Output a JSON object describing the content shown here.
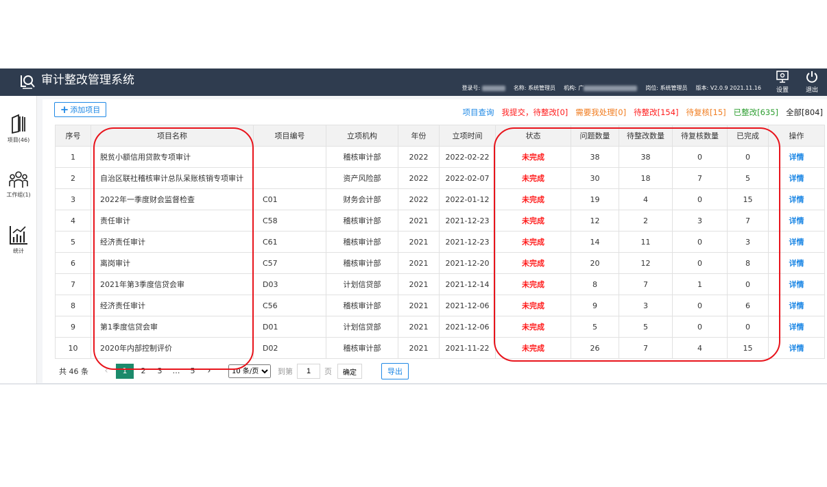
{
  "header": {
    "title": "审计整改管理系统",
    "login_label": "登录号:",
    "name_label": "名称:",
    "name_value": "系统管理员",
    "org_label": "机构:",
    "org_value_prefix": "广",
    "post_label": "岗位:",
    "post_value": "系统管理员",
    "version_label": "版本:",
    "version_value": "V2.0.9 2021.11.16",
    "settings_label": "设置",
    "logout_label": "退出"
  },
  "sidebar": {
    "items": [
      {
        "label": "项目(46)",
        "icon": "folder-icon"
      },
      {
        "label": "工作组(1)",
        "icon": "group-icon"
      },
      {
        "label": "统计",
        "icon": "chart-icon"
      }
    ]
  },
  "toolbar": {
    "add_label": "添加项目"
  },
  "filters": [
    {
      "label": "项目查询",
      "color": "#1e88e5"
    },
    {
      "label": "我提交，待整改[0]",
      "color": "#ff1a1a"
    },
    {
      "label": "需要我处理[0]",
      "color": "#f07c1f"
    },
    {
      "label": "待整改[154]",
      "color": "#ff1a1a"
    },
    {
      "label": "待复核[15]",
      "color": "#f07c1f"
    },
    {
      "label": "已整改[635]",
      "color": "#2e9e31"
    },
    {
      "label": "全部[804]",
      "color": "#222222"
    }
  ],
  "table": {
    "columns": [
      "序号",
      "项目名称",
      "项目编号",
      "立项机构",
      "年份",
      "立项时间",
      "状态",
      "问题数量",
      "待整改数量",
      "待复核数量",
      "已完成",
      "操作"
    ],
    "rows": [
      {
        "no": "1",
        "name": "脱贫小额信用贷款专项审计",
        "code": "",
        "org": "稽核审计部",
        "year": "2022",
        "date": "2022-02-22",
        "status": "未完成",
        "issues": "38",
        "pending": "38",
        "review": "0",
        "done": "0",
        "action": "详情"
      },
      {
        "no": "2",
        "name": "自治区联社稽核审计总队呆账核销专项审计",
        "code": "",
        "org": "资产风险部",
        "year": "2022",
        "date": "2022-02-07",
        "status": "未完成",
        "issues": "30",
        "pending": "18",
        "review": "7",
        "done": "5",
        "action": "详情"
      },
      {
        "no": "3",
        "name": "2022年一季度财会监督检查",
        "code": "C01",
        "org": "财务会计部",
        "year": "2022",
        "date": "2022-01-12",
        "status": "未完成",
        "issues": "19",
        "pending": "4",
        "review": "0",
        "done": "15",
        "action": "详情"
      },
      {
        "no": "4",
        "name": "责任审计",
        "code": "C58",
        "org": "稽核审计部",
        "year": "2021",
        "date": "2021-12-23",
        "status": "未完成",
        "issues": "12",
        "pending": "2",
        "review": "3",
        "done": "7",
        "action": "详情"
      },
      {
        "no": "5",
        "name": "经济责任审计",
        "code": "C61",
        "org": "稽核审计部",
        "year": "2021",
        "date": "2021-12-23",
        "status": "未完成",
        "issues": "14",
        "pending": "11",
        "review": "0",
        "done": "3",
        "action": "详情"
      },
      {
        "no": "6",
        "name": "离岗审计",
        "code": "C57",
        "org": "稽核审计部",
        "year": "2021",
        "date": "2021-12-20",
        "status": "未完成",
        "issues": "20",
        "pending": "12",
        "review": "0",
        "done": "8",
        "action": "详情"
      },
      {
        "no": "7",
        "name": "2021年第3季度信贷会审",
        "code": "D03",
        "org": "计划信贷部",
        "year": "2021",
        "date": "2021-12-14",
        "status": "未完成",
        "issues": "8",
        "pending": "7",
        "review": "1",
        "done": "0",
        "action": "详情"
      },
      {
        "no": "8",
        "name": "经济责任审计",
        "code": "C56",
        "org": "稽核审计部",
        "year": "2021",
        "date": "2021-12-06",
        "status": "未完成",
        "issues": "9",
        "pending": "3",
        "review": "0",
        "done": "6",
        "action": "详情"
      },
      {
        "no": "9",
        "name": "第1季度信贷会审",
        "code": "D01",
        "org": "计划信贷部",
        "year": "2021",
        "date": "2021-12-06",
        "status": "未完成",
        "issues": "5",
        "pending": "5",
        "review": "0",
        "done": "0",
        "action": "详情"
      },
      {
        "no": "10",
        "name": "2020年内部控制评价",
        "code": "D02",
        "org": "稽核审计部",
        "year": "2021",
        "date": "2021-11-22",
        "status": "未完成",
        "issues": "26",
        "pending": "7",
        "review": "4",
        "done": "15",
        "action": "详情"
      }
    ]
  },
  "pager": {
    "total": "共 46 条",
    "pages": [
      "1",
      "2",
      "3",
      "…",
      "5"
    ],
    "page_size": "10 条/页",
    "goto_label": "到第",
    "goto_value": "1",
    "page_unit": "页",
    "confirm": "确定",
    "export": "导出"
  },
  "colors": {
    "topbar": "#2f3c4f",
    "accent": "#1e88e5",
    "status_red": "#ff1a1a",
    "pager_active": "#1b8a6b",
    "annotation_red": "#e8131b"
  }
}
